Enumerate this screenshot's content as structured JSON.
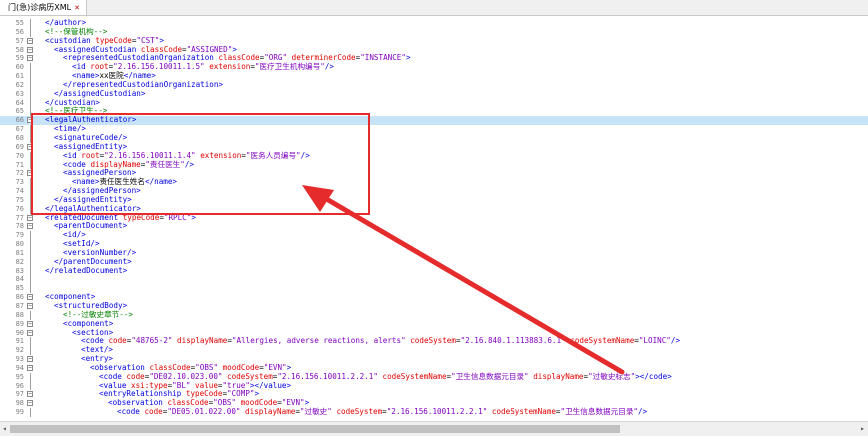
{
  "tab": {
    "label": "门(急)诊病历XML",
    "close_icon": "close-icon"
  },
  "lines": [
    {
      "n": "55",
      "i": 1,
      "hl": false,
      "fold": "line",
      "tok": [
        [
          "t",
          "</author>"
        ]
      ]
    },
    {
      "n": "56",
      "i": 1,
      "hl": false,
      "fold": "line",
      "tok": [
        [
          "c",
          "<!--保管机构-->"
        ]
      ]
    },
    {
      "n": "57",
      "i": 1,
      "hl": false,
      "fold": "box",
      "tok": [
        [
          "t",
          "<custodian "
        ],
        [
          "a",
          "typeCode"
        ],
        [
          "p",
          "="
        ],
        [
          "v",
          "\"CST\""
        ],
        [
          "t",
          ">"
        ]
      ]
    },
    {
      "n": "58",
      "i": 2,
      "hl": false,
      "fold": "box",
      "tok": [
        [
          "t",
          "<assignedCustodian "
        ],
        [
          "a",
          "classCode"
        ],
        [
          "p",
          "="
        ],
        [
          "v",
          "\"ASSIGNED\""
        ],
        [
          "t",
          ">"
        ]
      ]
    },
    {
      "n": "59",
      "i": 3,
      "hl": false,
      "fold": "box",
      "tok": [
        [
          "t",
          "<representedCustodianOrganization "
        ],
        [
          "a",
          "classCode"
        ],
        [
          "p",
          "="
        ],
        [
          "v",
          "\"ORG\""
        ],
        [
          "p",
          " "
        ],
        [
          "a",
          "determinerCode"
        ],
        [
          "p",
          "="
        ],
        [
          "v",
          "\"INSTANCE\""
        ],
        [
          "t",
          ">"
        ]
      ]
    },
    {
      "n": "60",
      "i": 4,
      "hl": false,
      "fold": "line",
      "tok": [
        [
          "t",
          "<id "
        ],
        [
          "a",
          "root"
        ],
        [
          "p",
          "="
        ],
        [
          "v",
          "\"2.16.156.10011.1.5\""
        ],
        [
          "p",
          " "
        ],
        [
          "a",
          "extension"
        ],
        [
          "p",
          "="
        ],
        [
          "v",
          "\"医疗卫生机构编号\""
        ],
        [
          "t",
          "/>"
        ]
      ]
    },
    {
      "n": "61",
      "i": 4,
      "hl": false,
      "fold": "line",
      "tok": [
        [
          "t",
          "<name>"
        ],
        [
          "p",
          "xx医院"
        ],
        [
          "t",
          "</name>"
        ]
      ]
    },
    {
      "n": "62",
      "i": 3,
      "hl": false,
      "fold": "line",
      "tok": [
        [
          "t",
          "</representedCustodianOrganization>"
        ]
      ]
    },
    {
      "n": "63",
      "i": 2,
      "hl": false,
      "fold": "line",
      "tok": [
        [
          "t",
          "</assignedCustodian>"
        ]
      ]
    },
    {
      "n": "64",
      "i": 1,
      "hl": false,
      "fold": "line",
      "tok": [
        [
          "t",
          "</custodian>"
        ]
      ]
    },
    {
      "n": "65",
      "i": 1,
      "hl": false,
      "fold": "line",
      "tok": [
        [
          "c",
          "<!--医疗卫生-->"
        ]
      ]
    },
    {
      "n": "66",
      "i": 1,
      "hl": true,
      "fold": "box",
      "tok": [
        [
          "t",
          "<legalAuthenticator>"
        ]
      ]
    },
    {
      "n": "67",
      "i": 2,
      "hl": false,
      "fold": "line",
      "tok": [
        [
          "t",
          "<time/>"
        ]
      ]
    },
    {
      "n": "68",
      "i": 2,
      "hl": false,
      "fold": "line",
      "tok": [
        [
          "t",
          "<signatureCode/>"
        ]
      ]
    },
    {
      "n": "69",
      "i": 2,
      "hl": false,
      "fold": "box",
      "tok": [
        [
          "t",
          "<assignedEntity>"
        ]
      ]
    },
    {
      "n": "70",
      "i": 3,
      "hl": false,
      "fold": "line",
      "tok": [
        [
          "t",
          "<id "
        ],
        [
          "a",
          "root"
        ],
        [
          "p",
          "="
        ],
        [
          "v",
          "\"2.16.156.10011.1.4\""
        ],
        [
          "p",
          " "
        ],
        [
          "a",
          "extension"
        ],
        [
          "p",
          "="
        ],
        [
          "v",
          "\"医务人员编号\""
        ],
        [
          "t",
          "/>"
        ]
      ]
    },
    {
      "n": "71",
      "i": 3,
      "hl": false,
      "fold": "line",
      "tok": [
        [
          "t",
          "<code "
        ],
        [
          "a",
          "displayName"
        ],
        [
          "p",
          "="
        ],
        [
          "v",
          "\"责任医生\""
        ],
        [
          "t",
          "/>"
        ]
      ]
    },
    {
      "n": "72",
      "i": 3,
      "hl": false,
      "fold": "box",
      "tok": [
        [
          "t",
          "<assignedPerson>"
        ]
      ]
    },
    {
      "n": "73",
      "i": 4,
      "hl": false,
      "fold": "line",
      "tok": [
        [
          "t",
          "<name>"
        ],
        [
          "p",
          "责任医生姓名"
        ],
        [
          "t",
          "</name>"
        ]
      ]
    },
    {
      "n": "74",
      "i": 3,
      "hl": false,
      "fold": "line",
      "tok": [
        [
          "t",
          "</assignedPerson>"
        ]
      ]
    },
    {
      "n": "75",
      "i": 2,
      "hl": false,
      "fold": "line",
      "tok": [
        [
          "t",
          "</assignedEntity>"
        ]
      ]
    },
    {
      "n": "76",
      "i": 1,
      "hl": false,
      "fold": "line",
      "tok": [
        [
          "t",
          "</legalAuthenticator>"
        ]
      ]
    },
    {
      "n": "77",
      "i": 1,
      "hl": false,
      "fold": "box",
      "tok": [
        [
          "t",
          "<relatedDocument "
        ],
        [
          "a",
          "typeCode"
        ],
        [
          "p",
          "="
        ],
        [
          "v",
          "\"RPLC\""
        ],
        [
          "t",
          ">"
        ]
      ]
    },
    {
      "n": "78",
      "i": 2,
      "hl": false,
      "fold": "box",
      "tok": [
        [
          "t",
          "<parentDocument>"
        ]
      ]
    },
    {
      "n": "79",
      "i": 3,
      "hl": false,
      "fold": "line",
      "tok": [
        [
          "t",
          "<id/>"
        ]
      ]
    },
    {
      "n": "80",
      "i": 3,
      "hl": false,
      "fold": "line",
      "tok": [
        [
          "t",
          "<setId/>"
        ]
      ]
    },
    {
      "n": "81",
      "i": 3,
      "hl": false,
      "fold": "line",
      "tok": [
        [
          "t",
          "<versionNumber/>"
        ]
      ]
    },
    {
      "n": "82",
      "i": 2,
      "hl": false,
      "fold": "line",
      "tok": [
        [
          "t",
          "</parentDocument>"
        ]
      ]
    },
    {
      "n": "83",
      "i": 1,
      "hl": false,
      "fold": "line",
      "tok": [
        [
          "t",
          "</relatedDocument>"
        ]
      ]
    },
    {
      "n": "84",
      "i": 0,
      "hl": false,
      "fold": "line",
      "tok": []
    },
    {
      "n": "85",
      "i": 0,
      "hl": false,
      "fold": "line",
      "tok": []
    },
    {
      "n": "86",
      "i": 1,
      "hl": false,
      "fold": "box",
      "tok": [
        [
          "t",
          "<component>"
        ]
      ]
    },
    {
      "n": "87",
      "i": 2,
      "hl": false,
      "fold": "box",
      "tok": [
        [
          "t",
          "<structuredBody>"
        ]
      ]
    },
    {
      "n": "88",
      "i": 3,
      "hl": false,
      "fold": "line",
      "tok": [
        [
          "c",
          "<!--过敏史章节-->"
        ]
      ]
    },
    {
      "n": "89",
      "i": 3,
      "hl": false,
      "fold": "box",
      "tok": [
        [
          "t",
          "<component>"
        ]
      ]
    },
    {
      "n": "90",
      "i": 4,
      "hl": false,
      "fold": "box",
      "tok": [
        [
          "t",
          "<section>"
        ]
      ]
    },
    {
      "n": "91",
      "i": 5,
      "hl": false,
      "fold": "line",
      "tok": [
        [
          "t",
          "<code "
        ],
        [
          "a",
          "code"
        ],
        [
          "p",
          "="
        ],
        [
          "v",
          "\"48765-2\""
        ],
        [
          "p",
          " "
        ],
        [
          "a",
          "displayName"
        ],
        [
          "p",
          "="
        ],
        [
          "v",
          "\"Allergies, adverse reactions, alerts\""
        ],
        [
          "p",
          " "
        ],
        [
          "a",
          "codeSystem"
        ],
        [
          "p",
          "="
        ],
        [
          "v",
          "\"2.16.840.1.113883.6.1\""
        ],
        [
          "p",
          " "
        ],
        [
          "a",
          "codeSystemName"
        ],
        [
          "p",
          "="
        ],
        [
          "v",
          "\"LOINC\""
        ],
        [
          "t",
          "/>"
        ]
      ]
    },
    {
      "n": "92",
      "i": 5,
      "hl": false,
      "fold": "line",
      "tok": [
        [
          "t",
          "<text/>"
        ]
      ]
    },
    {
      "n": "93",
      "i": 5,
      "hl": false,
      "fold": "box",
      "tok": [
        [
          "t",
          "<entry>"
        ]
      ]
    },
    {
      "n": "94",
      "i": 6,
      "hl": false,
      "fold": "box",
      "tok": [
        [
          "t",
          "<observation "
        ],
        [
          "a",
          "classCode"
        ],
        [
          "p",
          "="
        ],
        [
          "v",
          "\"OBS\""
        ],
        [
          "p",
          " "
        ],
        [
          "a",
          "moodCode"
        ],
        [
          "p",
          "="
        ],
        [
          "v",
          "\"EVN\""
        ],
        [
          "t",
          ">"
        ]
      ]
    },
    {
      "n": "95",
      "i": 7,
      "hl": false,
      "fold": "line",
      "tok": [
        [
          "t",
          "<code "
        ],
        [
          "a",
          "code"
        ],
        [
          "p",
          "="
        ],
        [
          "v",
          "\"DE02.10.023.00\""
        ],
        [
          "p",
          " "
        ],
        [
          "a",
          "codeSystem"
        ],
        [
          "p",
          "="
        ],
        [
          "v",
          "\"2.16.156.10011.2.2.1\""
        ],
        [
          "p",
          " "
        ],
        [
          "a",
          "codeSystemName"
        ],
        [
          "p",
          "="
        ],
        [
          "v",
          "\"卫生信息数据元目录\""
        ],
        [
          "p",
          " "
        ],
        [
          "a",
          "displayName"
        ],
        [
          "p",
          "="
        ],
        [
          "v",
          "\"过敏史标志\""
        ],
        [
          "t",
          "></code>"
        ]
      ]
    },
    {
      "n": "96",
      "i": 7,
      "hl": false,
      "fold": "line",
      "tok": [
        [
          "t",
          "<value "
        ],
        [
          "a",
          "xsi:type"
        ],
        [
          "p",
          "="
        ],
        [
          "v",
          "\"BL\""
        ],
        [
          "p",
          " "
        ],
        [
          "a",
          "value"
        ],
        [
          "p",
          "="
        ],
        [
          "v",
          "\"true\""
        ],
        [
          "t",
          "></value>"
        ]
      ]
    },
    {
      "n": "97",
      "i": 7,
      "hl": false,
      "fold": "box",
      "tok": [
        [
          "t",
          "<entryRelationship "
        ],
        [
          "a",
          "typeCode"
        ],
        [
          "p",
          "="
        ],
        [
          "v",
          "\"COMP\""
        ],
        [
          "t",
          ">"
        ]
      ]
    },
    {
      "n": "98",
      "i": 8,
      "hl": false,
      "fold": "box",
      "tok": [
        [
          "t",
          "<observation "
        ],
        [
          "a",
          "classCode"
        ],
        [
          "p",
          "="
        ],
        [
          "v",
          "\"OBS\""
        ],
        [
          "p",
          " "
        ],
        [
          "a",
          "moodCode"
        ],
        [
          "p",
          "="
        ],
        [
          "v",
          "\"EVN\""
        ],
        [
          "t",
          ">"
        ]
      ]
    },
    {
      "n": "99",
      "i": 9,
      "hl": false,
      "fold": "line",
      "tok": [
        [
          "t",
          "<code "
        ],
        [
          "a",
          "code"
        ],
        [
          "p",
          "="
        ],
        [
          "v",
          "\"DE05.01.022.00\""
        ],
        [
          "p",
          " "
        ],
        [
          "a",
          "displayName"
        ],
        [
          "p",
          "="
        ],
        [
          "v",
          "\"过敏史\""
        ],
        [
          "p",
          " "
        ],
        [
          "a",
          "codeSystem"
        ],
        [
          "p",
          "="
        ],
        [
          "v",
          "\"2.16.156.10011.2.2.1\""
        ],
        [
          "p",
          " "
        ],
        [
          "a",
          "codeSystemName"
        ],
        [
          "p",
          "="
        ],
        [
          "v",
          "\"卫生信息数据元目录\""
        ],
        [
          "t",
          "/>"
        ]
      ]
    }
  ],
  "colors": {
    "tag": "#0000e0",
    "attr": "#e00000",
    "value": "#8000c0",
    "comment": "#008000",
    "highlight": "#c7e3f7",
    "annotation": "#e52b2b"
  }
}
